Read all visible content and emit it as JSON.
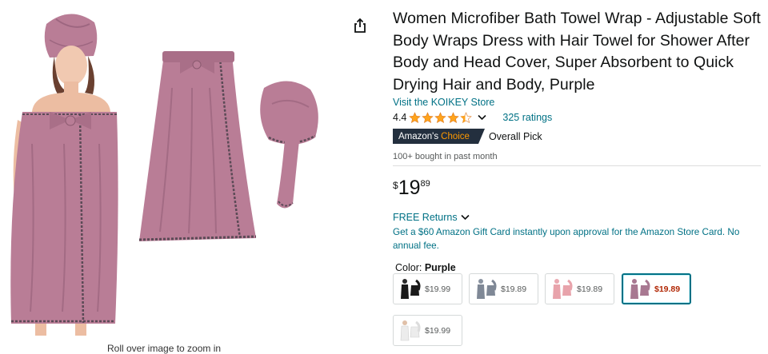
{
  "product": {
    "title": "Women Microfiber Bath Towel Wrap - Adjustable Soft Body Wraps Dress with Hair Towel for Shower After Body and Head Cover, Super Absorbent to Quick Drying Hair and Body, Purple",
    "store_link": "Visit the KOIKEY Store",
    "rating_value": "4.4",
    "rating_stars": 4.4,
    "ratings_count": "325 ratings",
    "badge_prefix": "Amazon's",
    "badge_choice": "Choice",
    "badge_pick": "Overall Pick",
    "bought": "100+ bought in past month",
    "price_symbol": "$",
    "price_whole": "19",
    "price_fraction": "89",
    "free_returns": "FREE Returns",
    "gift_card": "Get a $60 Amazon Gift Card instantly upon approval for the Amazon Store Card. No annual fee.",
    "color_label": "Color:",
    "color_value": "Purple"
  },
  "gallery": {
    "zoom_hint": "Roll over image to zoom in"
  },
  "colors": {
    "accent_link": "#007185",
    "price_red": "#b12704",
    "star": "#ffa41c",
    "badge_bg": "#232f3e",
    "badge_choice": "#ff9900",
    "towel_purple": "#b97d96"
  },
  "swatches": [
    {
      "price": "$19.99",
      "color": "#1a1a1a"
    },
    {
      "price": "$19.89",
      "color": "#7f8896"
    },
    {
      "price": "$19.89",
      "color": "#e8a3ab"
    },
    {
      "price": "$19.89",
      "color": "#a87891"
    },
    {
      "price": "$19.99",
      "color": "#ececec"
    }
  ]
}
